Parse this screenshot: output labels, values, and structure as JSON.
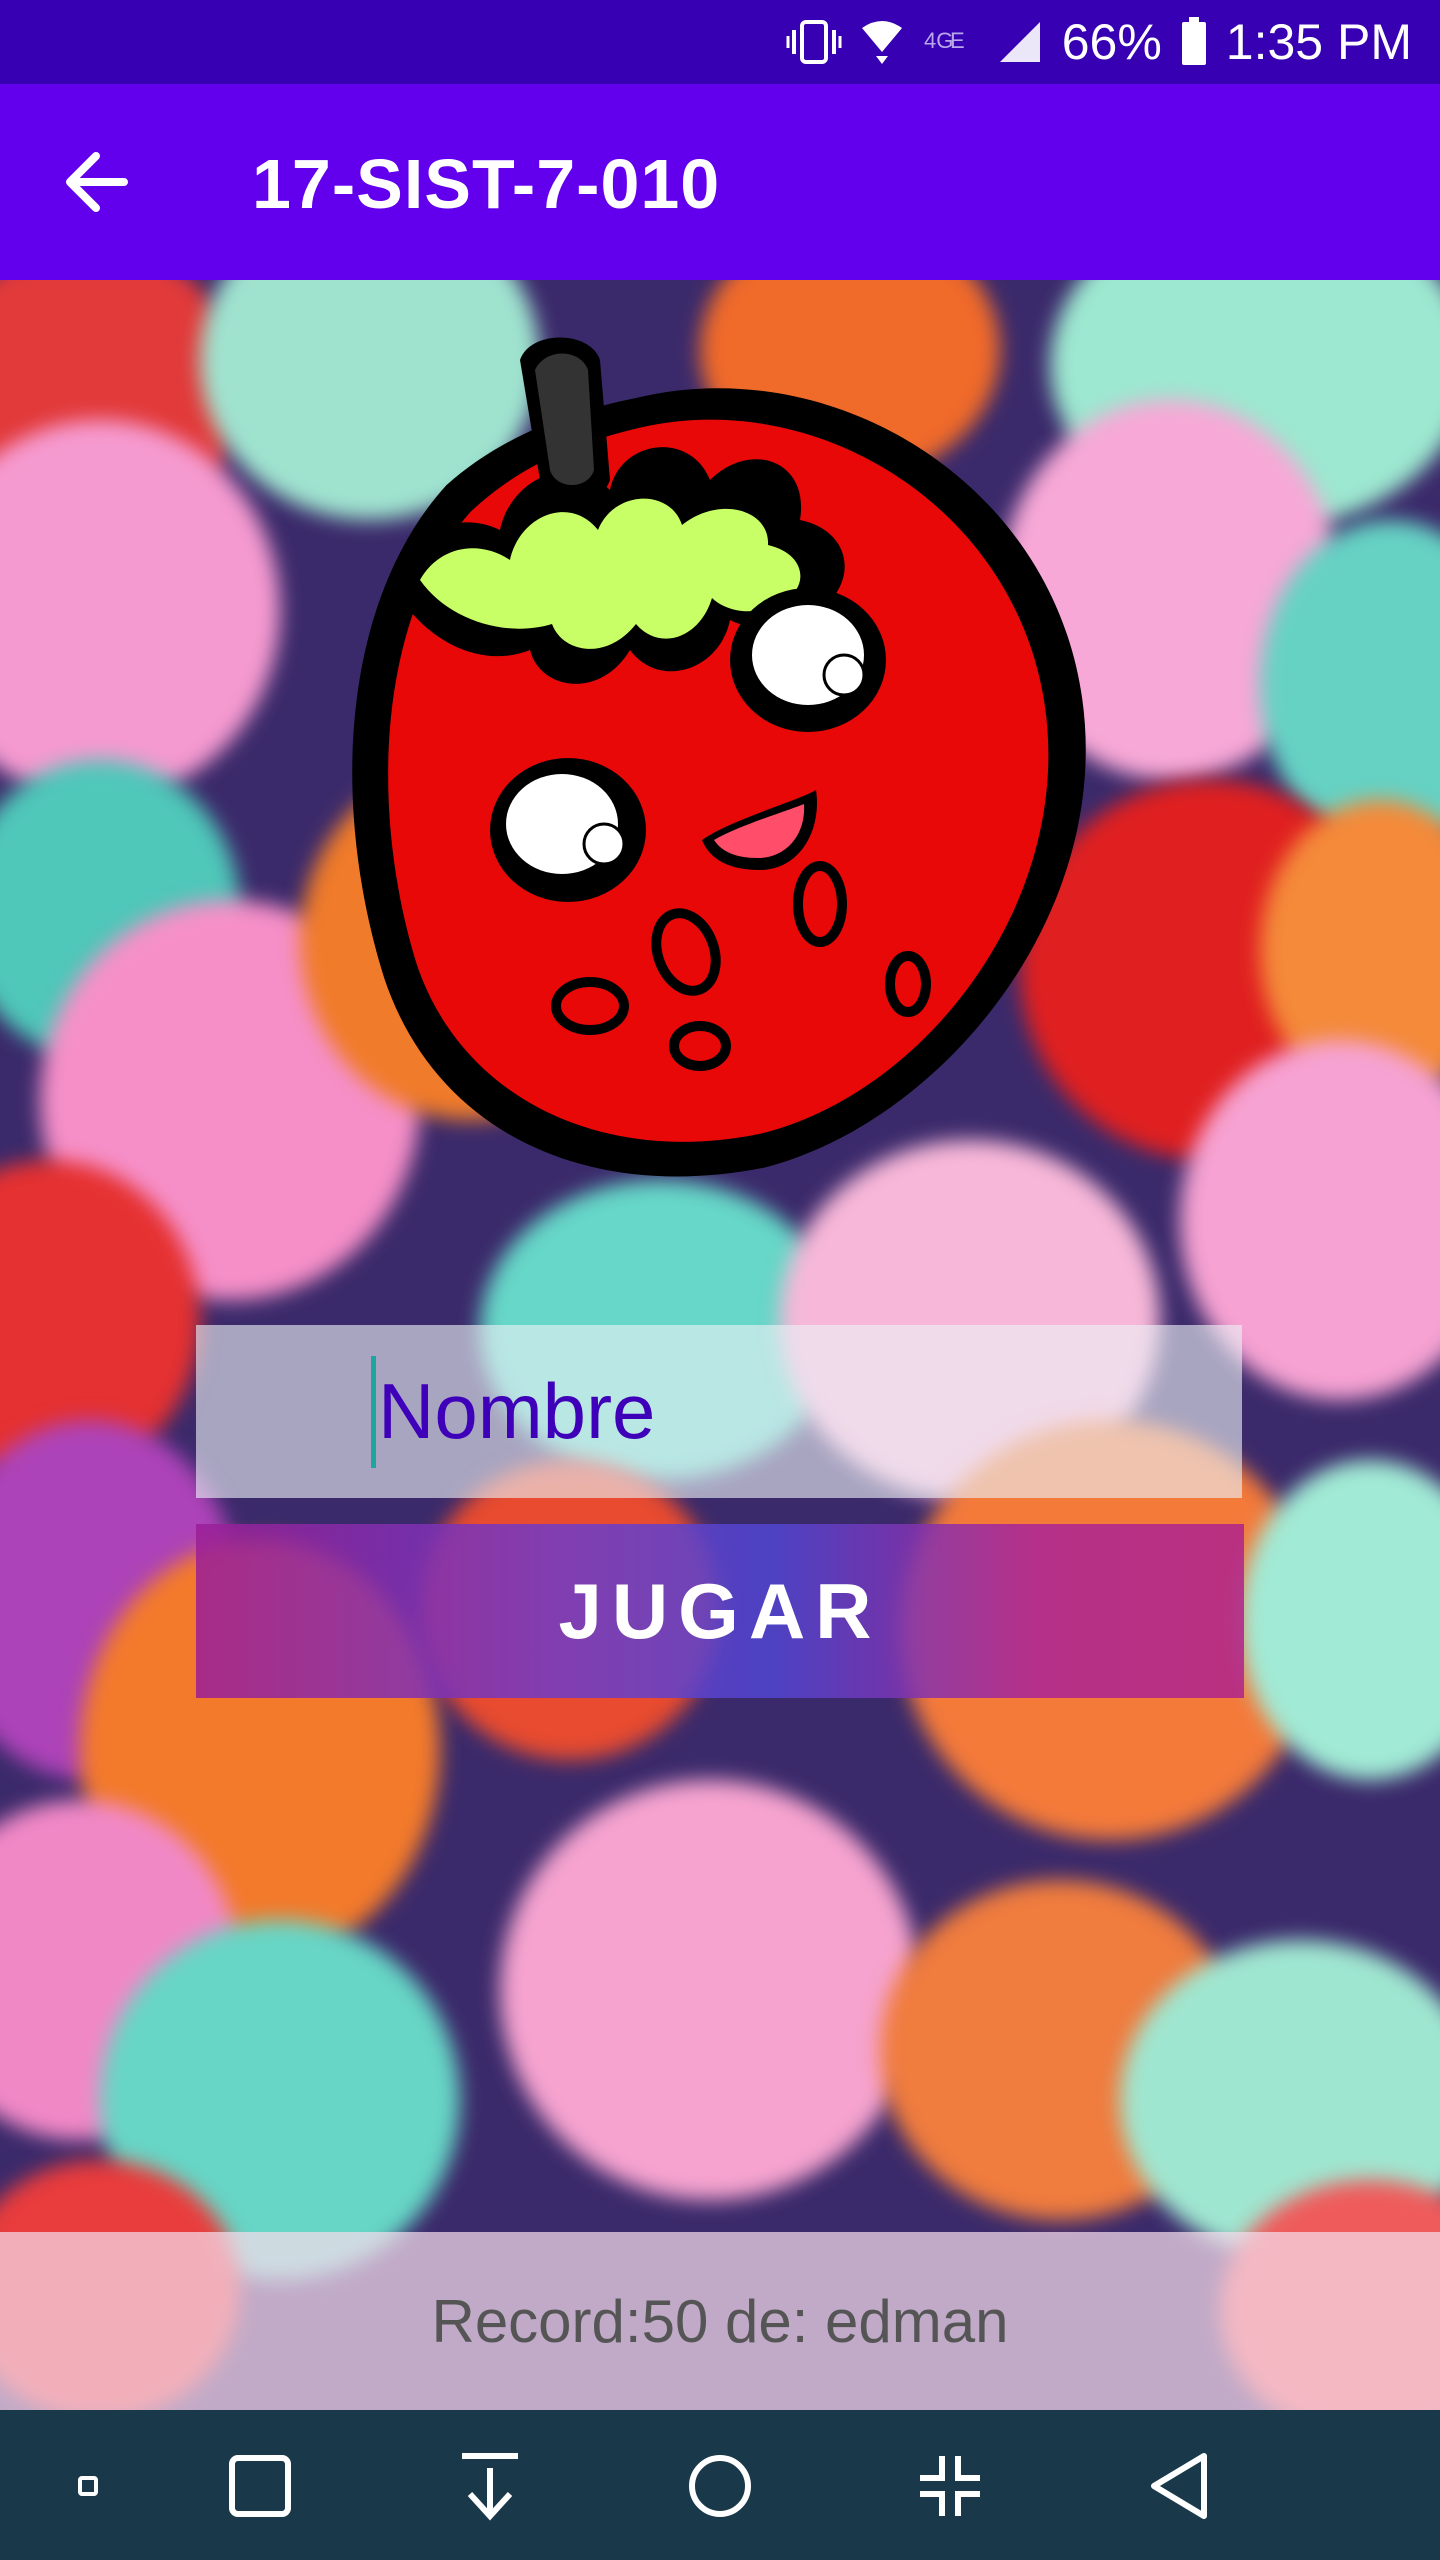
{
  "status_bar": {
    "battery": "66%",
    "time": "1:35 PM",
    "icons": [
      "vibrate-icon",
      "wifi-icon",
      "lte-icon",
      "signal-icon",
      "battery-icon"
    ]
  },
  "app_bar": {
    "title": "17-SIST-7-010",
    "back_icon": "arrow-left-icon",
    "color": "#6200ee"
  },
  "form": {
    "name_placeholder": "Nombre",
    "play_button_label": "JUGAR"
  },
  "record": {
    "text": "Record:50 de: edman"
  },
  "nav_bar": {
    "buttons": [
      "dot-icon",
      "square-icon",
      "download-icon",
      "home-circle-icon",
      "collapse-icon",
      "back-triangle-icon"
    ]
  },
  "colors": {
    "status_bar": "#3700b3",
    "accent": "#6200ee",
    "hint_text": "#3e00b8"
  }
}
